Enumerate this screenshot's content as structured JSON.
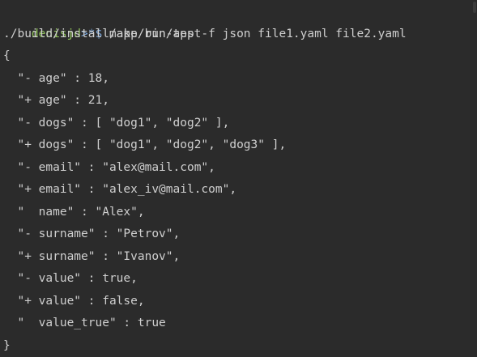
{
  "prompt": {
    "user": "denisjd",
    "symbol": ">*$",
    "command": "make run-test"
  },
  "command_echo": "./build/install/app/bin/app -f json file1.yaml file2.yaml",
  "output": [
    "{",
    "  \"- age\" : 18,",
    "  \"+ age\" : 21,",
    "  \"- dogs\" : [ \"dog1\", \"dog2\" ],",
    "  \"+ dogs\" : [ \"dog1\", \"dog2\", \"dog3\" ],",
    "  \"- email\" : \"alex@mail.com\",",
    "  \"+ email\" : \"alex_iv@mail.com\",",
    "  \"  name\" : \"Alex\",",
    "  \"- surname\" : \"Petrov\",",
    "  \"+ surname\" : \"Ivanov\",",
    "  \"- value\" : true,",
    "  \"+ value\" : false,",
    "  \"  value_true\" : true",
    "}"
  ]
}
